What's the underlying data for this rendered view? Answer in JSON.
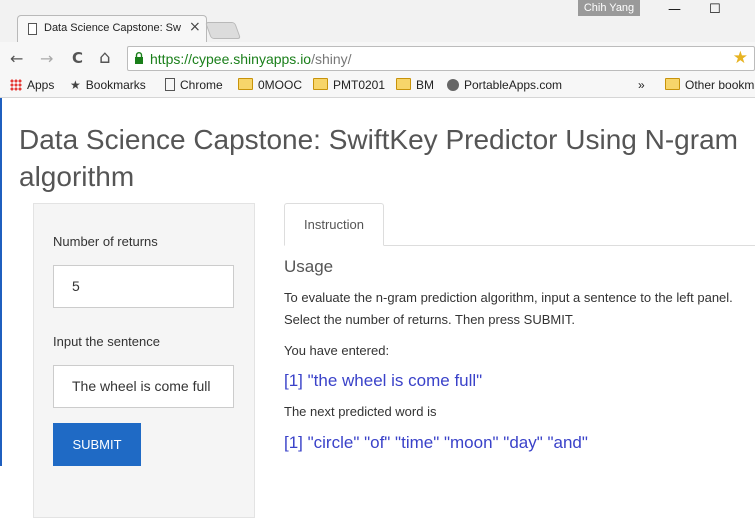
{
  "browser": {
    "tab_title": "Data Science Capstone: Sw",
    "tab_close": "×",
    "profile_name": "Chih Yang",
    "window_controls": {
      "minimize": "—",
      "maximize": "☐"
    },
    "nav": {
      "back": "←",
      "forward": "→",
      "reload": "C",
      "home": "⌂"
    },
    "url_host": "https://cypee.shinyapps.io",
    "url_path": "/shiny/",
    "icons": [
      "page-icon",
      "lock-icon",
      "star-icon",
      "apps-icon",
      "bookmark-star-icon",
      "folder-icon",
      "portableapps-icon"
    ],
    "accent_color": "#1a7f1a"
  },
  "bookmarks": [
    {
      "label": "Apps",
      "icon": "apps-icon"
    },
    {
      "label": "Bookmarks",
      "icon": "star-icon"
    },
    {
      "label": "Chrome",
      "icon": "page-icon"
    },
    {
      "label": "0MOOC",
      "icon": "folder-icon"
    },
    {
      "label": "PMT0201",
      "icon": "folder-icon"
    },
    {
      "label": "BM",
      "icon": "folder-icon"
    },
    {
      "label": "PortableApps.com",
      "icon": "portableapps-icon"
    },
    {
      "label": "»",
      "icon": ""
    },
    {
      "label": "Other bookm",
      "icon": "folder-icon"
    }
  ],
  "app": {
    "title": "Data Science Capstone: SwiftKey Predictor Using N-gram algorithm",
    "sidebar": {
      "num_returns_label": "Number of returns",
      "num_returns_value": "5",
      "sentence_label": "Input the sentence",
      "sentence_value": "The wheel is come full",
      "submit_label": "SUBMIT"
    },
    "main": {
      "tab_label": "Instruction",
      "usage_heading": "Usage",
      "instructions": "To evaluate the n-gram prediction algorithm, input a sentence to the left panel. Select the number of returns. Then press SUBMIT.",
      "entered_label": "You have entered:",
      "entered_output": "[1] \"the wheel is come full\"",
      "predicted_label": "The next predicted word is",
      "predicted_output": "[1] \"circle\" \"of\" \"time\" \"moon\" \"day\" \"and\""
    },
    "colors": {
      "button": "#1f6ac5",
      "output_text": "#3a42c9"
    }
  }
}
